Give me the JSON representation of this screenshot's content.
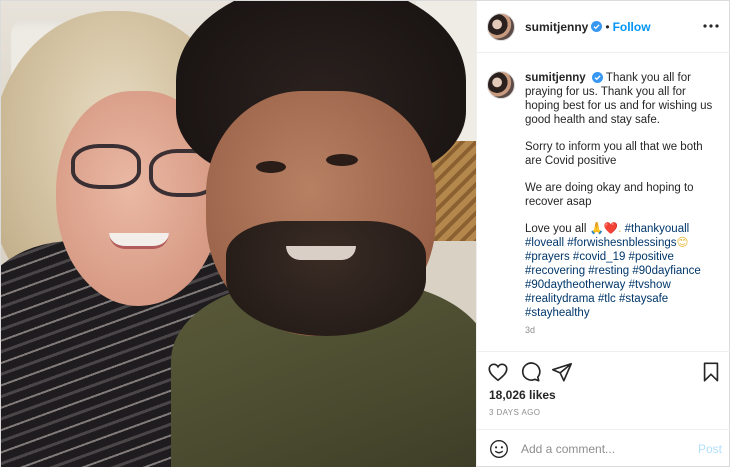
{
  "post": {
    "username": "sumitjenny",
    "follow_label": "Follow",
    "separator": "•",
    "photo_icon": "selfie-photo"
  },
  "caption": {
    "username": "sumitjenny",
    "paragraph1": "Thank you all for praying for us. Thank you all for hoping best for us and for wishing us good health and stay safe.",
    "paragraph2": "Sorry to inform you all that we both are Covid positive",
    "paragraph3": "We are doing okay and hoping to recover asap",
    "love_text": "Love you all ",
    "love_emojis": "🙏❤️.",
    "tag_thankyouall": "#thankyouall",
    "tag_loveall": "#loveall",
    "tag_forwishes": "#forwishesnblessings",
    "smile_emoji": "😊",
    "hashtags": "#prayers #covid_19 #positive #recovering #resting #90dayfiance #90daytheotherway #tvshow #realitydrama #tlc #staysafe #stayhealthy",
    "time_ago": "3d"
  },
  "actions": {
    "icons": [
      "heart-icon",
      "comment-icon",
      "share-icon",
      "bookmark-icon"
    ]
  },
  "likes": "18,026 likes",
  "date": "3 DAYS AGO",
  "comment_box": {
    "placeholder": "Add a comment...",
    "post_label": "Post"
  },
  "colors": {
    "link_blue": "#0095f6",
    "hashtag": "#00376b",
    "muted": "#8e8e8e"
  }
}
